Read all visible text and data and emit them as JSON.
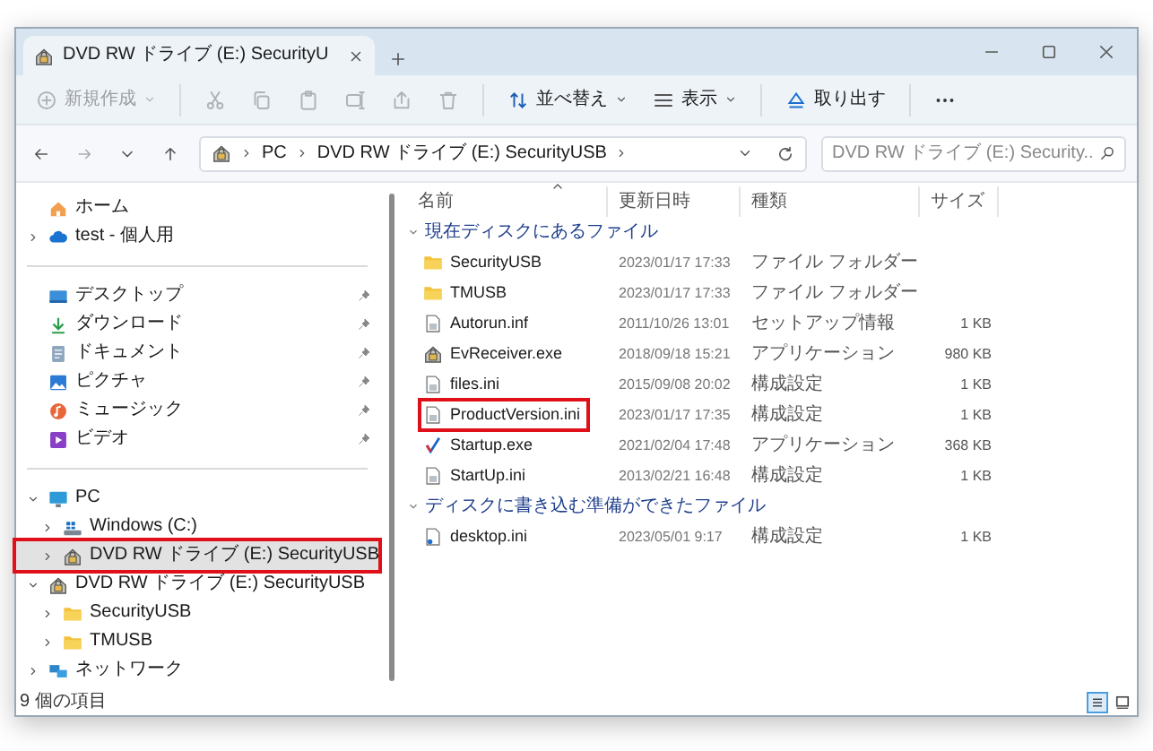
{
  "window": {
    "tab_title": "DVD RW ドライブ (E:) SecurityU"
  },
  "toolbar": [
    {
      "kind": "new",
      "label": "新規作成",
      "disabled": true
    },
    {
      "kind": "cut",
      "disabled": true
    },
    {
      "kind": "copy",
      "disabled": true
    },
    {
      "kind": "paste",
      "disabled": true
    },
    {
      "kind": "rename",
      "disabled": true
    },
    {
      "kind": "share",
      "disabled": true
    },
    {
      "kind": "delete",
      "disabled": true
    },
    {
      "kind": "sort",
      "label": "並べ替え",
      "disabled": false
    },
    {
      "kind": "view",
      "label": "表示",
      "disabled": false
    },
    {
      "kind": "eject",
      "label": "取り出す",
      "disabled": false
    },
    {
      "kind": "more",
      "disabled": false
    }
  ],
  "address": {
    "breadcrumbs": [
      "PC",
      "DVD RW ドライブ (E:) SecurityUSB"
    ]
  },
  "search": {
    "placeholder": "DVD RW ドライブ (E:) Security..."
  },
  "sidebar": {
    "sections": [
      [
        {
          "label": "ホーム",
          "kind": "home",
          "selected": false,
          "highlighted": false
        },
        {
          "label": "test - 個人用",
          "kind": "cloud",
          "expanded": false,
          "selected": false,
          "highlighted": false
        }
      ],
      [
        {
          "label": "デスクトップ",
          "kind": "desktop",
          "pinned": true,
          "selected": false,
          "highlighted": false
        },
        {
          "label": "ダウンロード",
          "kind": "download",
          "pinned": true,
          "selected": false,
          "highlighted": false
        },
        {
          "label": "ドキュメント",
          "kind": "document",
          "pinned": true,
          "selected": false,
          "highlighted": false
        },
        {
          "label": "ピクチャ",
          "kind": "picture",
          "pinned": true,
          "selected": false,
          "highlighted": false
        },
        {
          "label": "ミュージック",
          "kind": "music",
          "pinned": true,
          "selected": false,
          "highlighted": false
        },
        {
          "label": "ビデオ",
          "kind": "video",
          "pinned": true,
          "selected": false,
          "highlighted": false
        }
      ],
      [
        {
          "label": "PC",
          "kind": "pc",
          "expanded": true,
          "selected": false,
          "highlighted": false,
          "children": [
            {
              "label": "Windows (C:)",
              "kind": "drive",
              "expanded": false,
              "selected": false,
              "highlighted": false
            },
            {
              "label": "DVD RW ドライブ (E:) SecurityUSB",
              "kind": "dvd",
              "expanded": false,
              "selected": true,
              "highlighted": true
            }
          ]
        },
        {
          "label": "DVD RW ドライブ (E:) SecurityUSB",
          "kind": "dvd",
          "expanded": true,
          "selected": false,
          "highlighted": false,
          "children": [
            {
              "label": "SecurityUSB",
              "kind": "folder",
              "expanded": false,
              "selected": false,
              "highlighted": false
            },
            {
              "label": "TMUSB",
              "kind": "folder",
              "expanded": false,
              "selected": false,
              "highlighted": false
            }
          ]
        },
        {
          "label": "ネットワーク",
          "kind": "network",
          "expanded": false,
          "selected": false,
          "highlighted": false
        }
      ]
    ]
  },
  "columns": [
    "名前",
    "更新日時",
    "種類",
    "サイズ"
  ],
  "groups": [
    {
      "title": "現在ディスクにあるファイル",
      "expanded": true,
      "files": [
        {
          "name": "SecurityUSB",
          "date": "2023/01/17 17:33",
          "type": "ファイル フォルダー",
          "kind": "folder",
          "highlighted": false
        },
        {
          "name": "TMUSB",
          "date": "2023/01/17 17:33",
          "type": "ファイル フォルダー",
          "kind": "folder",
          "highlighted": false
        },
        {
          "name": "Autorun.inf",
          "date": "2011/10/26 13:01",
          "type": "セットアップ情報",
          "size": "1 KB",
          "kind": "file",
          "highlighted": false
        },
        {
          "name": "EvReceiver.exe",
          "date": "2018/09/18 15:21",
          "type": "アプリケーション",
          "size": "980 KB",
          "kind": "lockapp",
          "highlighted": false
        },
        {
          "name": "files.ini",
          "date": "2015/09/08 20:02",
          "type": "構成設定",
          "size": "1 KB",
          "kind": "file",
          "highlighted": false
        },
        {
          "name": "ProductVersion.ini",
          "date": "2023/01/17 17:35",
          "type": "構成設定",
          "size": "1 KB",
          "kind": "file",
          "highlighted": true
        },
        {
          "name": "Startup.exe",
          "date": "2021/02/04 17:48",
          "type": "アプリケーション",
          "size": "368 KB",
          "kind": "checkapp",
          "highlighted": false
        },
        {
          "name": "StartUp.ini",
          "date": "2013/02/21 16:48",
          "type": "構成設定",
          "size": "1 KB",
          "kind": "file",
          "highlighted": false
        }
      ]
    },
    {
      "title": "ディスクに書き込む準備ができたファイル",
      "expanded": true,
      "files": [
        {
          "name": "desktop.ini",
          "date": "2023/05/01 9:17",
          "type": "構成設定",
          "size": "1 KB",
          "kind": "pendingfile",
          "highlighted": false
        }
      ]
    }
  ],
  "status_bar": {
    "item_count": "9 個の項目"
  },
  "view_buttons": [
    {
      "kind": "details",
      "selected": true
    },
    {
      "kind": "tiles",
      "selected": false
    }
  ]
}
